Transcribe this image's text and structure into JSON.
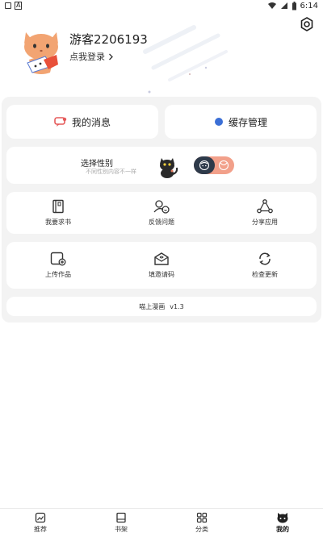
{
  "status_bar": {
    "time": "6:14"
  },
  "profile": {
    "username": "游客2206193",
    "login_prompt": "点我登录"
  },
  "quick_actions": {
    "messages_label": "我的消息",
    "cache_label": "缓存管理"
  },
  "gender": {
    "title": "选择性别",
    "subtitle": "不同性别内容不一样"
  },
  "grid_row1": [
    {
      "label": "我要求书",
      "icon": "book-icon"
    },
    {
      "label": "反馈问题",
      "icon": "feedback-icon"
    },
    {
      "label": "分享应用",
      "icon": "share-icon"
    }
  ],
  "grid_row2": [
    {
      "label": "上传作品",
      "icon": "upload-icon"
    },
    {
      "label": "填邀请码",
      "icon": "invite-mail-icon"
    },
    {
      "label": "检查更新",
      "icon": "refresh-icon"
    }
  ],
  "version": {
    "app_name": "喵上漫画",
    "number": "v1.3"
  },
  "bottom_nav": [
    {
      "label": "推荐",
      "icon": "recommend-icon"
    },
    {
      "label": "书架",
      "icon": "bookshelf-icon"
    },
    {
      "label": "分类",
      "icon": "category-icon"
    },
    {
      "label": "我的",
      "icon": "cat-face-icon",
      "active": true
    }
  ],
  "colors": {
    "toggle_bg": "#f2a08a",
    "toggle_knob": "#2e3a4a",
    "cache_dot": "#3b6fd6",
    "message_icon": "#e55a5a"
  }
}
